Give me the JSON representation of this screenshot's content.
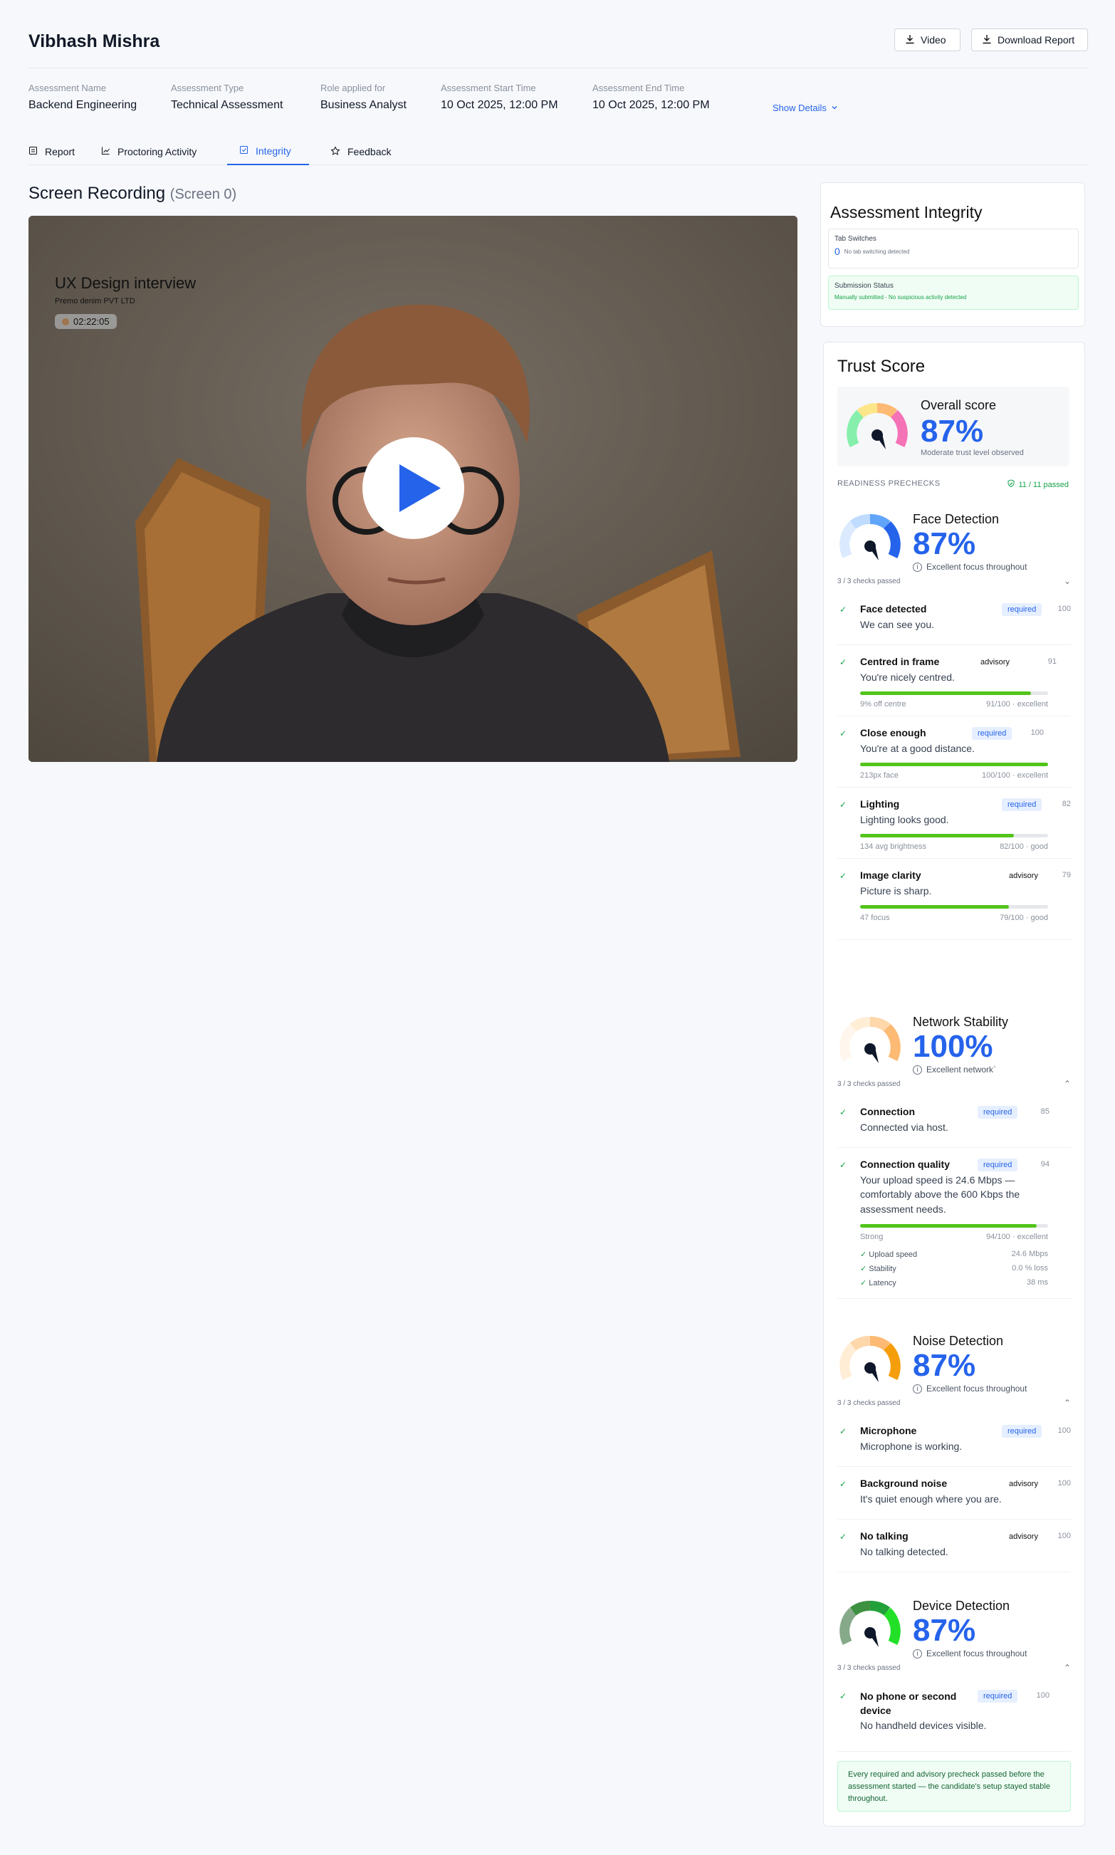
{
  "candidate_name": "Vibhash Mishra",
  "buttons": {
    "video": "Video",
    "download": "Download Report"
  },
  "meta": [
    {
      "label": "Assessment Name",
      "value": "Backend Engineering"
    },
    {
      "label": "Assessment Type",
      "value": "Technical Assessment"
    },
    {
      "label": "Role applied for",
      "value": "Business Analyst"
    },
    {
      "label": "Assessment Start Time",
      "value": "10 Oct 2025, 12:00 PM"
    },
    {
      "label": "Assessment End Time",
      "value": "10 Oct 2025, 12:00 PM"
    }
  ],
  "show_details": "Show Details",
  "tabs": [
    {
      "label": "Report"
    },
    {
      "label": "Proctoring Activity"
    },
    {
      "label": "Integrity",
      "active": true
    },
    {
      "label": "Feedback"
    }
  ],
  "recording": {
    "title": "Screen Recording",
    "sub": "(Screen 0)",
    "video_title": "UX Design interview",
    "company": "Premo denim PVT LTD",
    "time": "02:22:05"
  },
  "integrity": {
    "title": "Assessment Integrity",
    "tab_label": "Tab Switches",
    "tab_count": "0",
    "tab_note": "No tab switching detected",
    "sub_label": "Submission Status",
    "sub_note": "Manually submitted - No suspicious activity detected"
  },
  "trust": {
    "title": "Trust Score",
    "overall_label": "Overall score",
    "overall_value": "87%",
    "overall_note": "Moderate trust level observed",
    "precheck_label": "READINESS PRECHECKS",
    "precheck_passed": "11 / 11 passed"
  },
  "face": {
    "title": "Face Detection",
    "value": "87%",
    "note": "Excellent focus throughout",
    "checks": "3 / 3 checks passed",
    "items": [
      {
        "t": "Face detected",
        "d": "We can see you.",
        "b": "required",
        "n": "100"
      },
      {
        "t": "Centred in frame",
        "d": "You're nicely centred.",
        "b": "advisory",
        "n": "91",
        "bl": "9% off centre",
        "br": "91/100 · excellent",
        "v": 0.91
      },
      {
        "t": "Close enough",
        "d": "You're at a good distance.",
        "b": "required",
        "n": "100",
        "bl": "213px face",
        "br": "100/100 · excellent",
        "v": 1.0
      },
      {
        "t": "Lighting",
        "d": "Lighting looks good.",
        "b": "required",
        "n": "82",
        "bl": "134 avg brightness",
        "br": "82/100 · good",
        "v": 0.82
      },
      {
        "t": "Image clarity",
        "d": "Picture is sharp.",
        "b": "advisory",
        "n": "79",
        "bl": "47 focus",
        "br": "79/100 · good",
        "v": 0.79
      }
    ]
  },
  "network": {
    "title": "Network Stability",
    "value": "100%",
    "note": "Excellent network`",
    "checks": "3 / 3 checks passed",
    "items": [
      {
        "t": "Connection",
        "d": "Connected via host.",
        "b": "required",
        "n": "85"
      },
      {
        "t": "Connection quality",
        "d": "Your upload speed is 24.6 Mbps — comfortably above the 600 Kbps the assessment needs.",
        "b": "required",
        "n": "94",
        "bl": "Strong",
        "br": "94/100 · excellent",
        "v": 0.94
      }
    ],
    "sub": [
      {
        "k": "Upload speed",
        "v": "24.6 Mbps"
      },
      {
        "k": "Stability",
        "v": "0.0 % loss"
      },
      {
        "k": "Latency",
        "v": "38 ms"
      }
    ]
  },
  "noise": {
    "title": "Noise Detection",
    "value": "87%",
    "note": "Excellent focus throughout",
    "checks": "3 / 3 checks passed",
    "items": [
      {
        "t": "Microphone",
        "d": "Microphone is working.",
        "b": "required",
        "n": "100"
      },
      {
        "t": "Background noise",
        "d": "It's quiet enough where you are.",
        "b": "advisory",
        "n": "100"
      },
      {
        "t": "No talking",
        "d": "No talking detected.",
        "b": "advisory",
        "n": "100"
      }
    ]
  },
  "device": {
    "title": "Device Detection",
    "value": "87%",
    "note": "Excellent focus throughout",
    "checks": "3 / 3 checks passed",
    "items": [
      {
        "t": "No phone or second device",
        "d": "No handheld devices visible.",
        "b": "required",
        "n": "100"
      }
    ]
  },
  "footer_note": "Every required and advisory precheck passed before the assessment started — the candidate's setup stayed stable throughout."
}
